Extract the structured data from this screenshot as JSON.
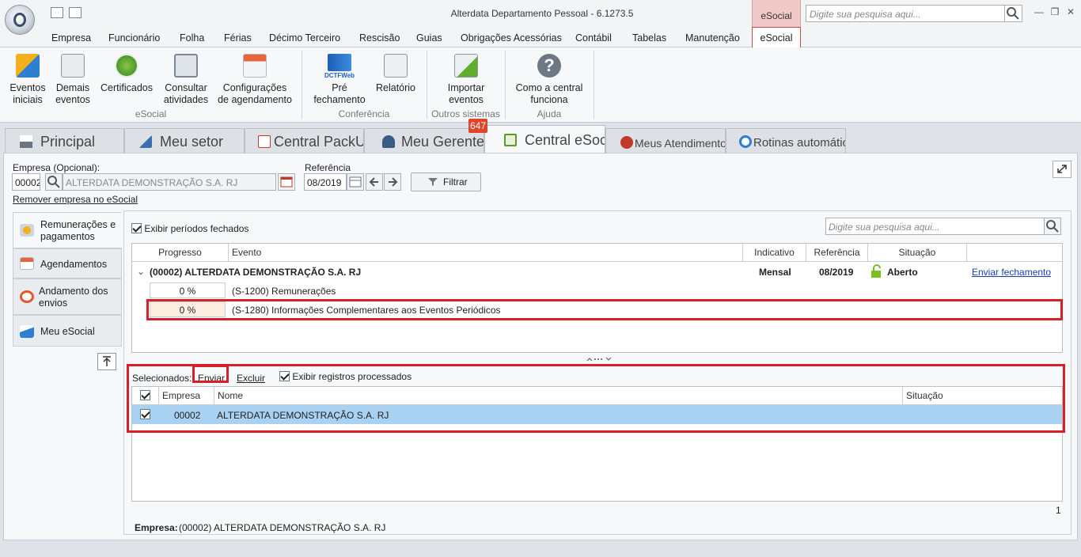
{
  "window": {
    "title": "Alterdata Departamento Pessoal - 6.1273.5",
    "context_tab": "eSocial",
    "search_placeholder": "Digite sua pesquisa aqui..."
  },
  "menu": [
    "Empresa",
    "Funcionário",
    "Folha",
    "Férias",
    "Décimo Terceiro",
    "Rescisão",
    "Guias",
    "Obrigações Acessórias",
    "Contábil",
    "Tabelas",
    "Manutenção",
    "eSocial"
  ],
  "ribbon": {
    "buttons": [
      {
        "l1": "Eventos",
        "l2": "iniciais"
      },
      {
        "l1": "Demais",
        "l2": "eventos"
      },
      {
        "l1": "Certificados",
        "l2": ""
      },
      {
        "l1": "Consultar",
        "l2": "atividades"
      },
      {
        "l1": "Configurações",
        "l2": "de agendamento"
      },
      {
        "l1": "Pré",
        "l2": "fechamento"
      },
      {
        "l1": "Relatório",
        "l2": ""
      },
      {
        "l1": "Importar",
        "l2": "eventos"
      },
      {
        "l1": "Como a central",
        "l2": "funciona"
      }
    ],
    "dctf_label": "DCTFWeb",
    "groups": [
      "eSocial",
      "Conferência",
      "Outros sistemas",
      "Ajuda"
    ]
  },
  "tabs": [
    "Principal",
    "Meu setor",
    "Central PackUp",
    "Meu Gerente",
    "Central eSocial",
    "Meus Atendimentos",
    "Rotinas automáticas"
  ],
  "badge": "647",
  "filters": {
    "empresa_label": "Empresa (Opcional):",
    "empresa_code": "00002",
    "empresa_name": "ALTERDATA DEMONSTRAÇÃO S.A. RJ",
    "referencia_label": "Referência",
    "referencia_value": "08/2019",
    "filtrar": "Filtrar",
    "remover_link": "Remover empresa no eSocial"
  },
  "sidenav": [
    {
      "l1": "Remunerações e",
      "l2": "pagamentos"
    },
    {
      "l1": "Agendamentos",
      "l2": ""
    },
    {
      "l1": "Andamento dos",
      "l2": "envios"
    },
    {
      "l1": "Meu eSocial",
      "l2": ""
    }
  ],
  "events": {
    "exibir_fechados": "Exibir períodos fechados",
    "search_placeholder": "Digite sua pesquisa aqui...",
    "headers": [
      "Progresso",
      "Evento",
      "Indicativo",
      "Referência",
      "Situação"
    ],
    "group": {
      "name": "(00002) ALTERDATA DEMONSTRAÇÃO S.A. RJ",
      "indicativo": "Mensal",
      "referencia": "08/2019",
      "situacao": "Aberto",
      "action": "Enviar fechamento"
    },
    "rows": [
      {
        "progress": "0 %",
        "evento": "(S-1200) Remunerações"
      },
      {
        "progress": "0 %",
        "evento": "(S-1280) Informações Complementares aos Eventos Periódicos"
      }
    ]
  },
  "lower": {
    "selecionados": "Selecionados:",
    "enviar": "Enviar",
    "excluir": "Excluir",
    "exibir_processados": "Exibir registros processados",
    "headers": [
      "Empresa",
      "Nome",
      "Situação"
    ],
    "row": {
      "empresa": "00002",
      "nome": "ALTERDATA DEMONSTRAÇÃO S.A. RJ",
      "situacao": ""
    },
    "count": "1",
    "footer_label": "Empresa:",
    "footer_value": "(00002) ALTERDATA DEMONSTRAÇÃO S.A. RJ"
  },
  "colors": {
    "accent_red": "#d61f26",
    "selection": "#a9d1f2",
    "badge": "#e0442a",
    "aberto_icon": "#7bbf1f"
  }
}
